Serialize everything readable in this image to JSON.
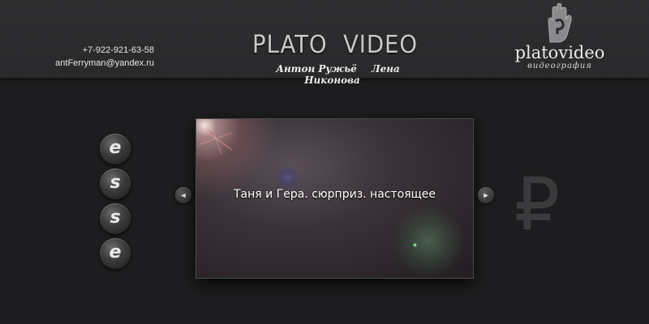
{
  "header": {
    "phone": "+7-922-921-63-58",
    "email": "antFerryman@yandex.ru",
    "title": "PLATO  VIDEO",
    "authors": [
      "Антон Ружьё",
      "Лена Никонова"
    ]
  },
  "logo": {
    "name": "platovideo",
    "subtitle": "видеография",
    "icon": "hand-icon"
  },
  "social": {
    "buttons": [
      {
        "label": "e",
        "icon": "social-e-icon"
      },
      {
        "label": "s",
        "icon": "social-s-icon"
      },
      {
        "label": "s",
        "icon": "social-s-icon"
      },
      {
        "label": "e",
        "icon": "social-e-icon"
      }
    ]
  },
  "slider": {
    "prev_icon": "◄",
    "next_icon": "►",
    "caption": "Таня и Гера. сюрприз. настоящее"
  },
  "price_icon": {
    "symbol": "₽",
    "icon": "ruble-icon"
  }
}
